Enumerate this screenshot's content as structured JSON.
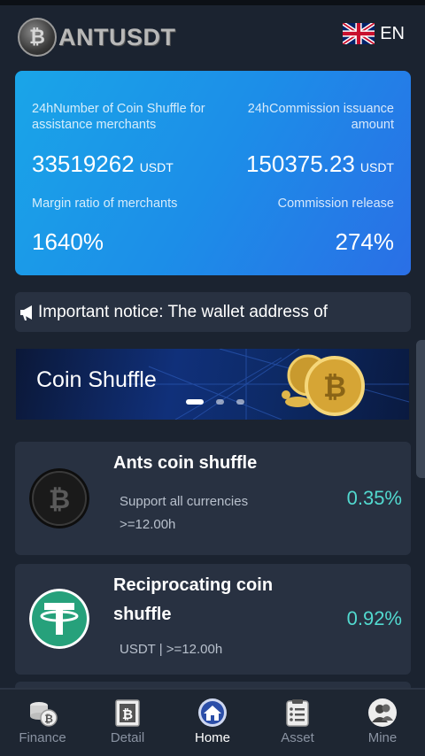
{
  "header": {
    "logo_text": "ANTUSDT",
    "logo_icon": "bitcoin-coin-logo",
    "language": "EN",
    "flag_icon": "uk-flag-icon"
  },
  "stats": {
    "items": [
      {
        "label": "24hNumber of Coin Shuffle for assistance merchants",
        "value": "33519262",
        "unit": "USDT"
      },
      {
        "label": "24hCommission issuance amount",
        "value": "150375.23",
        "unit": "USDT"
      },
      {
        "label": "Margin ratio of merchants",
        "value": "1640%"
      },
      {
        "label": "Commission release",
        "value": "274%"
      }
    ]
  },
  "notice": {
    "icon": "megaphone-icon",
    "text": "Important notice: The wallet address of"
  },
  "banner": {
    "title": "Coin Shuffle",
    "slide_count": 3,
    "active_slide": 1
  },
  "cards": [
    {
      "title": "Ants coin shuffle",
      "sub_lines": [
        "Support all currencies",
        ">=12.00h"
      ],
      "rate": "0.35%",
      "icon": "black-bitcoin-icon"
    },
    {
      "title_lines": [
        "Reciprocating coin",
        "shuffle"
      ],
      "sub": "USDT | >=12.00h",
      "rate": "0.92%",
      "icon": "tether-icon"
    }
  ],
  "tabs": [
    {
      "label": "Finance",
      "icon": "coins-icon",
      "active": false
    },
    {
      "label": "Detail",
      "icon": "bitcoin-doc-icon",
      "active": false
    },
    {
      "label": "Home",
      "icon": "home-icon",
      "active": true
    },
    {
      "label": "Asset",
      "icon": "clipboard-icon",
      "active": false
    },
    {
      "label": "Mine",
      "icon": "user-icon",
      "active": false
    }
  ],
  "colors": {
    "background": "#1b2330",
    "card": "#283141",
    "accent_rate": "#52d9cf",
    "stats_gradient_start": "#1aa5e8",
    "stats_gradient_end": "#2a6fe6"
  }
}
